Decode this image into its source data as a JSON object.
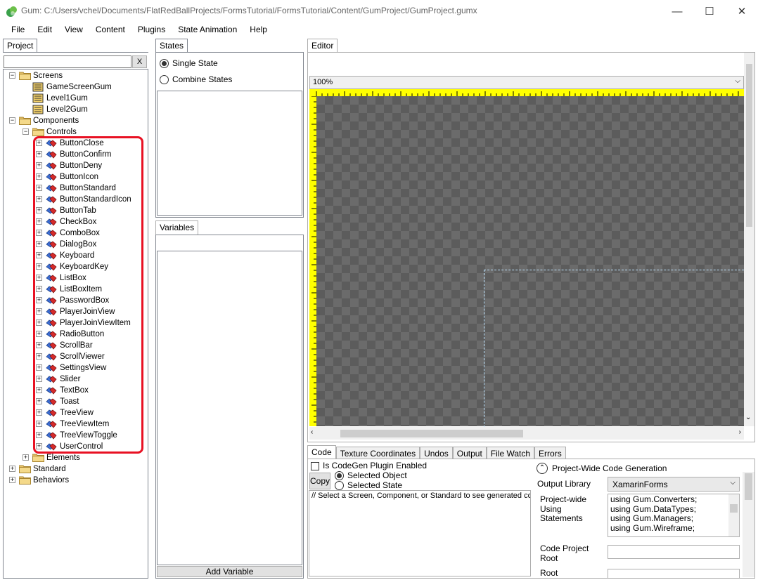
{
  "window": {
    "title": "Gum: C:/Users/vchel/Documents/FlatRedBallProjects/FormsTutorial/FormsTutorial/Content/GumProject/GumProject.gumx",
    "minimize": "—",
    "maximize": "☐",
    "close": "✕"
  },
  "menu": [
    "File",
    "Edit",
    "View",
    "Content",
    "Plugins",
    "State Animation",
    "Help"
  ],
  "project": {
    "tab": "Project",
    "search_value": "",
    "clear_label": "X",
    "tree": {
      "screens": {
        "label": "Screens",
        "items": [
          "GameScreenGum",
          "Level1Gum",
          "Level2Gum"
        ]
      },
      "components": {
        "label": "Components"
      },
      "controls": {
        "label": "Controls",
        "items": [
          "ButtonClose",
          "ButtonConfirm",
          "ButtonDeny",
          "ButtonIcon",
          "ButtonStandard",
          "ButtonStandardIcon",
          "ButtonTab",
          "CheckBox",
          "ComboBox",
          "DialogBox",
          "Keyboard",
          "KeyboardKey",
          "ListBox",
          "ListBoxItem",
          "PasswordBox",
          "PlayerJoinView",
          "PlayerJoinViewItem",
          "RadioButton",
          "ScrollBar",
          "ScrollViewer",
          "SettingsView",
          "Slider",
          "TextBox",
          "Toast",
          "TreeView",
          "TreeViewItem",
          "TreeViewToggle",
          "UserControl"
        ]
      },
      "elements": {
        "label": "Elements"
      },
      "standard": {
        "label": "Standard"
      },
      "behaviors": {
        "label": "Behaviors"
      }
    },
    "highlight_color": "#e81123"
  },
  "states": {
    "tab": "States",
    "single_state": "Single State",
    "combine_states": "Combine States",
    "selected": "single"
  },
  "variables": {
    "tab": "Variables",
    "add_button": "Add Variable"
  },
  "editor": {
    "tab": "Editor",
    "zoom": "100%",
    "ruler_color": "#ffff00"
  },
  "bottom": {
    "tabs": [
      "Code",
      "Texture Coordinates",
      "Undos",
      "Output",
      "File Watch",
      "Errors"
    ],
    "active_tab": "Code",
    "codegen_enabled_label": "Is CodeGen Plugin Enabled",
    "copy_button": "Copy",
    "selected_object": "Selected Object",
    "selected_state": "Selected State",
    "code_text": "// Select a Screen, Component, or Standard to see generated co",
    "project_wide": {
      "header": "Project-Wide Code Generation",
      "output_library_label": "Output Library",
      "output_library_value": "XamarinForms",
      "using_label": "Project-wide Using Statements",
      "using_lines": [
        "using Gum.Converters;",
        "using Gum.DataTypes;",
        "using Gum.Managers;",
        "using Gum.Wireframe;"
      ],
      "code_project_root_label": "Code Project Root",
      "code_project_root_value": "",
      "root_label": "Root",
      "root_value": ""
    }
  }
}
